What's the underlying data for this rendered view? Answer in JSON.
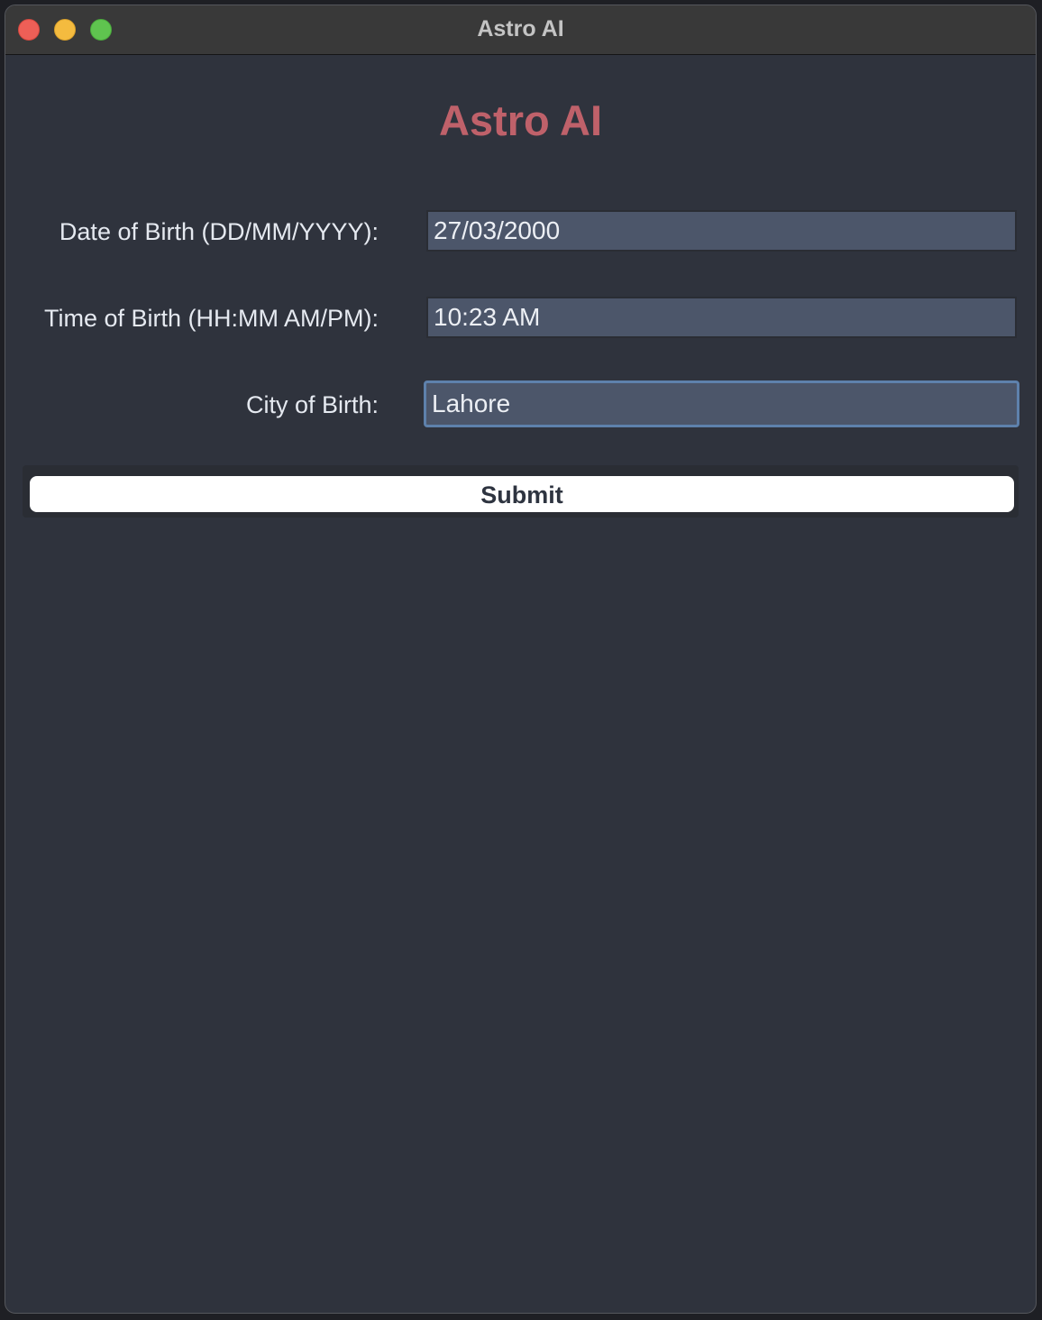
{
  "window": {
    "title": "Astro AI"
  },
  "app": {
    "heading": "Astro AI"
  },
  "form": {
    "dob": {
      "label": "Date of Birth (DD/MM/YYYY):",
      "value": "27/03/2000"
    },
    "tob": {
      "label": "Time of Birth (HH:MM AM/PM):",
      "value": "10:23 AM"
    },
    "city": {
      "label": "City of Birth:",
      "value": "Lahore"
    },
    "submit_label": "Submit"
  },
  "colors": {
    "heading": "#bf616a",
    "background": "#2f333d",
    "input_bg": "#4c566a",
    "focus_border": "#5e81ac"
  }
}
